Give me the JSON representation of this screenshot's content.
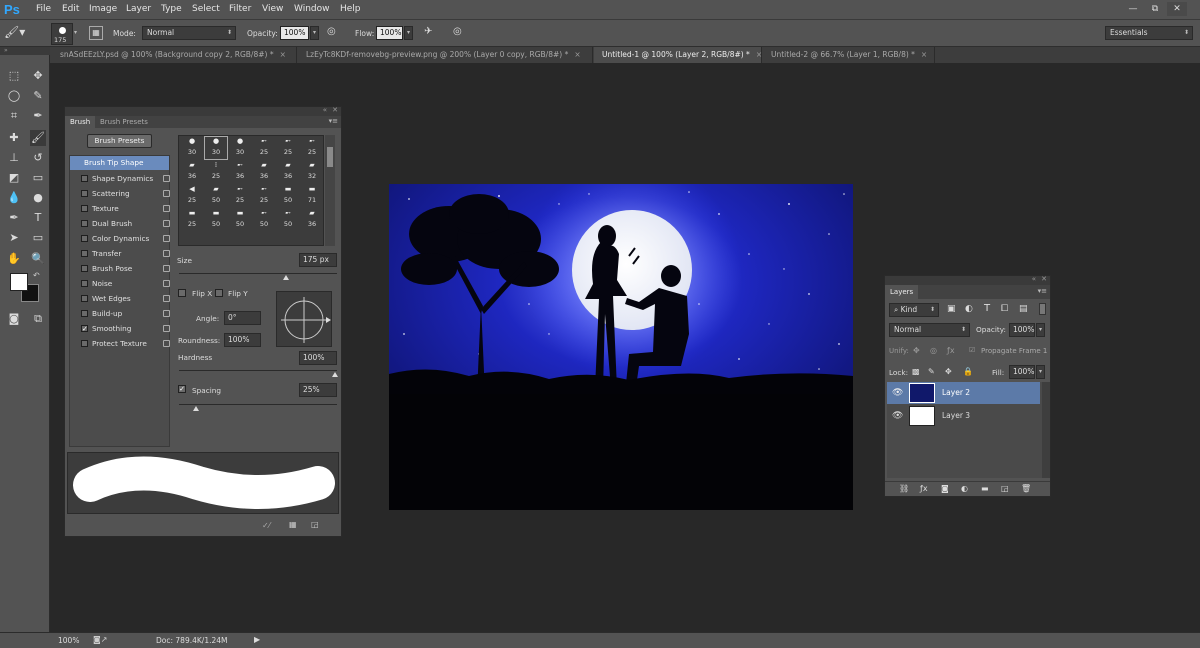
{
  "app": {
    "logo": "Ps"
  },
  "menu": [
    "File",
    "Edit",
    "Image",
    "Layer",
    "Type",
    "Select",
    "Filter",
    "View",
    "Window",
    "Help"
  ],
  "window_controls": {
    "minimize": "—",
    "restore": "⧉",
    "close": "✕"
  },
  "options": {
    "brush_size": "175",
    "mode_label": "Mode:",
    "mode_value": "Normal",
    "opacity_label": "Opacity:",
    "opacity_value": "100%",
    "flow_label": "Flow:",
    "flow_value": "100%",
    "workspace": "Essentials"
  },
  "doc_tabs": [
    {
      "label": "snASdEEzLY.psd @ 100% (Background copy 2, RGB/8#) *",
      "close": "×"
    },
    {
      "label": "LzEyTc8KDf-removebg-preview.png @ 200% (Layer 0 copy, RGB/8#) *",
      "close": "×"
    },
    {
      "label": "Untitled-1 @ 100% (Layer 2, RGB/8#) *",
      "close": "×"
    },
    {
      "label": "Untitled-2 @ 66.7% (Layer 1, RGB/8) *",
      "close": "×"
    }
  ],
  "brush_panel": {
    "tabs": [
      "Brush",
      "Brush Presets"
    ],
    "presets_button": "Brush Presets",
    "tip_shape_label": "Brush Tip Shape",
    "options": [
      {
        "label": "Shape Dynamics",
        "checked": false
      },
      {
        "label": "Scattering",
        "checked": false
      },
      {
        "label": "Texture",
        "checked": false
      },
      {
        "label": "Dual Brush",
        "checked": false
      },
      {
        "label": "Color Dynamics",
        "checked": false
      },
      {
        "label": "Transfer",
        "checked": false
      },
      {
        "label": "Brush Pose",
        "checked": false
      },
      {
        "label": "Noise",
        "checked": false
      },
      {
        "label": "Wet Edges",
        "checked": false
      },
      {
        "label": "Build-up",
        "checked": false
      },
      {
        "label": "Smoothing",
        "checked": true
      },
      {
        "label": "Protect Texture",
        "checked": false
      }
    ],
    "tip_sizes": [
      [
        "30",
        "30",
        "30",
        "25",
        "25",
        "25"
      ],
      [
        "36",
        "25",
        "36",
        "36",
        "36",
        "32"
      ],
      [
        "25",
        "50",
        "25",
        "25",
        "50",
        "71"
      ],
      [
        "25",
        "50",
        "50",
        "50",
        "50",
        "36"
      ]
    ],
    "size_label": "Size",
    "size_value": "175 px",
    "flip_x": "Flip X",
    "flip_y": "Flip Y",
    "angle_label": "Angle:",
    "angle_value": "0°",
    "roundness_label": "Roundness:",
    "roundness_value": "100%",
    "hardness_label": "Hardness",
    "hardness_value": "100%",
    "spacing_label": "Spacing",
    "spacing_value": "25%"
  },
  "layers_panel": {
    "title": "Layers",
    "filter_kind": "Kind",
    "blend_mode": "Normal",
    "opacity_label": "Opacity:",
    "opacity_value": "100%",
    "unify_label": "Unify:",
    "propagate_label": "Propagate Frame 1",
    "lock_label": "Lock:",
    "fill_label": "Fill:",
    "fill_value": "100%",
    "layers": [
      {
        "name": "Layer 2",
        "selected": true
      },
      {
        "name": "Layer 3",
        "selected": false
      }
    ]
  },
  "status": {
    "zoom": "100%",
    "doc_info": "Doc: 789.4K/1.24M"
  },
  "colors": {
    "ui_panel": "#535353",
    "canvas_bg": "#282828",
    "sky": "#1a1f9e",
    "selected_layer": "#5c7aa8"
  }
}
